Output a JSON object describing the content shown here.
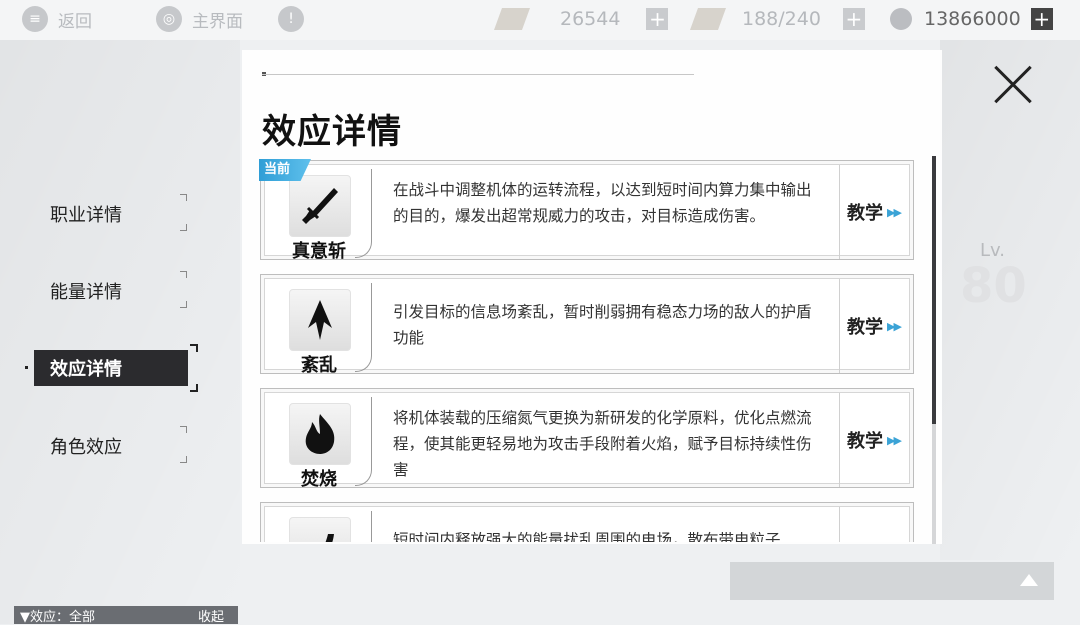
{
  "topbar": {
    "back_label": "返回",
    "main_label": "主界面",
    "alert_glyph": "!",
    "resource1": "26544",
    "resource2": "188/240",
    "resource3": "13866000",
    "plus_glyph": "+"
  },
  "menu": {
    "items": [
      {
        "label": "职业详情"
      },
      {
        "label": "能量详情"
      },
      {
        "label": "效应详情"
      },
      {
        "label": "角色效应"
      }
    ],
    "active_index": 2
  },
  "panel": {
    "title": "效应详情",
    "badge": "当前",
    "teach_label": "教学",
    "teach_arrow": "▶▶",
    "effects": [
      {
        "name": "真意斩",
        "icon": "sword-icon",
        "desc": "在战斗中调整机体的运转流程，以达到短时间内算力集中输出的目的，爆发出超常规威力的攻击，对目标造成伤害。"
      },
      {
        "name": "紊乱",
        "icon": "shard-icon",
        "desc": "引发目标的信息场紊乱，暂时削弱拥有稳态力场的敌人的护盾功能"
      },
      {
        "name": "焚烧",
        "icon": "flame-icon",
        "desc": "将机体装载的压缩氮气更换为新研发的化学原料，优化点燃流程，使其能更轻易地为攻击手段附着火焰，赋予目标持续性伤害"
      },
      {
        "name": "",
        "icon": "crescent-icon",
        "desc": "短时间内释放强大的能量扰乱周围的电场，散布带电粒子"
      }
    ]
  },
  "right": {
    "lv_label": "Lv.",
    "lv_value": "80"
  },
  "bottom": {
    "filter_label": "▼效应：全部",
    "collapse_label": "收起"
  },
  "colors": {
    "accent": "#3ba3d6",
    "active_bg": "#2b2b2e"
  }
}
